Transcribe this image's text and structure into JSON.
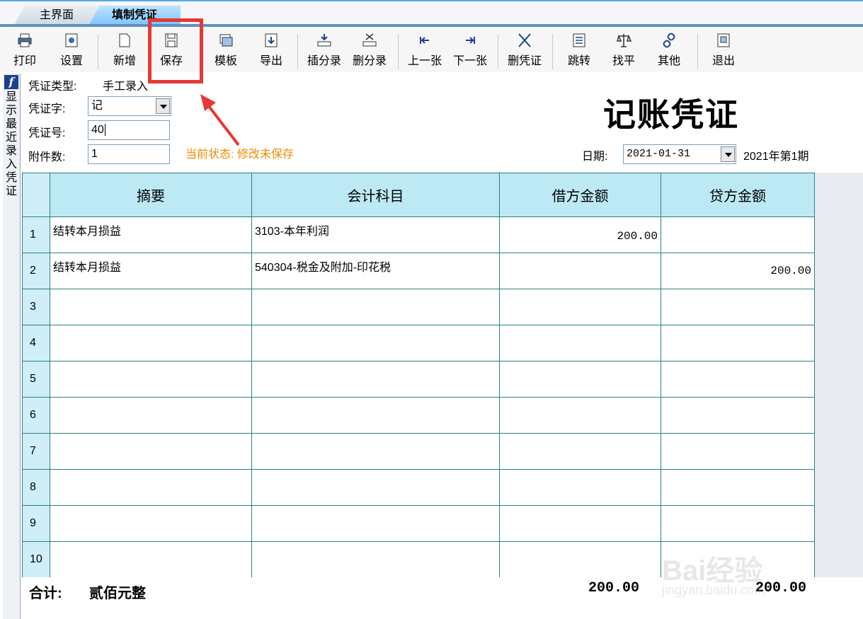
{
  "tabs": [
    {
      "label": "主界面",
      "active": false
    },
    {
      "label": "填制凭证",
      "active": true
    }
  ],
  "toolbar": {
    "print": "打印",
    "settings": "设置",
    "new": "新增",
    "save": "保存",
    "template": "模板",
    "export": "导出",
    "insert_entry": "插分录",
    "delete_entry": "删分录",
    "prev": "上一张",
    "next": "下一张",
    "delete_voucher": "删凭证",
    "jump": "跳转",
    "balance": "找平",
    "other": "其他",
    "exit": "退出"
  },
  "side_panel": {
    "text": "显示最近录入凭证"
  },
  "form": {
    "voucher_type_label": "凭证类型:",
    "voucher_type_value": "手工录入",
    "voucher_word_label": "凭证字:",
    "voucher_word_value": "记",
    "voucher_no_label": "凭证号:",
    "voucher_no_value": "40",
    "attachments_label": "附件数:",
    "attachments_value": "1",
    "status": "当前状态: 修改未保存",
    "date_label": "日期:",
    "date_value": "2021-01-31",
    "period": "2021年第1期"
  },
  "title": "记账凭证",
  "table": {
    "headers": [
      "摘要",
      "会计科目",
      "借方金额",
      "贷方金额"
    ],
    "rows": [
      {
        "num": "1",
        "summary": "结转本月损益",
        "account": "3103-本年利润",
        "debit": "200.00",
        "credit": ""
      },
      {
        "num": "2",
        "summary": "结转本月损益",
        "account": "540304-税金及附加-印花税",
        "debit": "",
        "credit": "200.00"
      },
      {
        "num": "3",
        "summary": "",
        "account": "",
        "debit": "",
        "credit": ""
      },
      {
        "num": "4",
        "summary": "",
        "account": "",
        "debit": "",
        "credit": ""
      },
      {
        "num": "5",
        "summary": "",
        "account": "",
        "debit": "",
        "credit": ""
      },
      {
        "num": "6",
        "summary": "",
        "account": "",
        "debit": "",
        "credit": ""
      },
      {
        "num": "7",
        "summary": "",
        "account": "",
        "debit": "",
        "credit": ""
      },
      {
        "num": "8",
        "summary": "",
        "account": "",
        "debit": "",
        "credit": ""
      },
      {
        "num": "9",
        "summary": "",
        "account": "",
        "debit": "",
        "credit": ""
      },
      {
        "num": "10",
        "summary": "",
        "account": "",
        "debit": "",
        "credit": ""
      }
    ]
  },
  "totals": {
    "label": "合计:",
    "amount_in_words": "贰佰元整",
    "debit_total": "200.00",
    "credit_total": "200.00"
  },
  "watermark": {
    "text": "Bai经验",
    "sub": "jingyan.baidu.com"
  },
  "colors": {
    "accent_header": "#bde9f5",
    "status_orange": "#f08a00",
    "annotation_red": "#e53935",
    "grid_line": "#2f7f7f"
  }
}
